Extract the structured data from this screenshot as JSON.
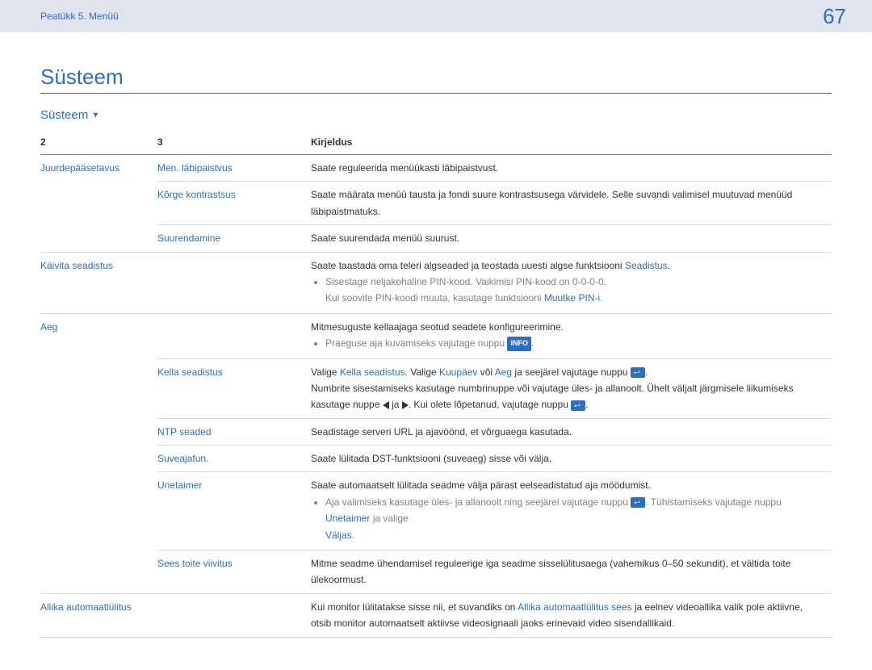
{
  "header": {
    "breadcrumb": "Peatükk 5. Menüü",
    "pageNumber": "67"
  },
  "title": "Süsteem",
  "section": {
    "name": "Süsteem",
    "caret": "▼"
  },
  "columns": {
    "c2": "2",
    "c3": "3",
    "desc": "Kirjeldus"
  },
  "rows": {
    "juurdepaasetavus": {
      "label": "Juurdepääsetavus"
    },
    "menlabipaistvus": {
      "label": "Men. läbipaistvus",
      "desc": "Saate reguleerida menüükasti läbipaistvust."
    },
    "korgekontrastsus": {
      "label": "Kõrge kontrastsus",
      "desc": "Saate määrata menüü tausta ja fondi suure kontrastsusega värvidele. Selle suvandi valimisel muutuvad menüüd läbipaistmatuks."
    },
    "suurendamine": {
      "label": "Suurendamine",
      "desc": "Saate suurendada menüü suurust."
    },
    "kaivitaseadistus": {
      "label": "Käivita seadistus",
      "desc1a": "Saate taastada oma teleri algseaded ja teostada uuesti algse funktsiooni ",
      "desc1b": "Seadistus",
      "desc1c": ".",
      "bullet1": "Sisestage neljakohaline PIN-kood. Vaikimisi PIN-kood on 0-0-0-0.",
      "bullet2a": "Kui soovite PIN-koodi muuta, kasutage funktsiooni ",
      "bullet2b": "Muutke PIN-i",
      "bullet2c": "."
    },
    "aeg": {
      "label": "Aeg",
      "desc": "Mitmesuguste kellaajaga seotud seadete konfigureerimine.",
      "bullet1a": "Praeguse aja kuvamiseks vajutage nuppu ",
      "bullet1b": "INFO",
      "bullet1c": "."
    },
    "kellaseadistus": {
      "label": "Kella seadistus",
      "line1a": "Valige ",
      "line1b": "Kella seadistus",
      "line1c": ". Valige ",
      "line1d": "Kuupäev",
      "line1e": " või ",
      "line1f": "Aeg",
      "line1g": " ja seejärel vajutage nuppu ",
      "line1h": ".",
      "line2a": "Numbrite sisestamiseks kasutage numbrinuppe või vajutage üles- ja allanoolt. Ühelt väljalt järgmisele liikumiseks kasutage nuppe ",
      "line2b": " ja ",
      "line2c": ". Kui olete lõpetanud, vajutage nuppu ",
      "line2d": "."
    },
    "ntpseaded": {
      "label": "NTP seaded",
      "desc": "Seadistage serveri URL ja ajavöönd, et võrguaega kasutada."
    },
    "suveajafun": {
      "label": "Suveajafun.",
      "desc": "Saate lülitada DST-funktsiooni (suveaeg) sisse või välja."
    },
    "unetaimer": {
      "label": "Unetaimer",
      "desc": "Saate automaatselt lülitada seadme välja pärast eelseadistatud aja möödumist.",
      "bullet1a": "Aja valimiseks kasutage üles- ja allanoolt ning seejärel vajutage nuppu ",
      "bullet1b": ". Tühistamiseks vajutage nuppu ",
      "bullet1c": "Unetaimer",
      "bullet1d": " ja valige ",
      "bullet1e": "Väljas",
      "bullet1f": "."
    },
    "seestoiteviivitus": {
      "label": "Sees toite viivitus",
      "desc": "Mitme seadme ühendamisel reguleerige iga seadme sisselülitusaega (vahemikus 0–50 sekundit), et vältida toite ülekoormust."
    },
    "allikaautomaat": {
      "label": "Allika automaatlülitus",
      "desc1a": "Kui monitor lülitatakse sisse nii, et suvandiks on ",
      "desc1b": "Allika automaatlülitus sees",
      "desc1c": " ja eelnev videoallika valik pole aktiivne, otsib monitor automaatselt aktiivse videosignaali jaoks erinevaid video sisendallikaid."
    }
  }
}
